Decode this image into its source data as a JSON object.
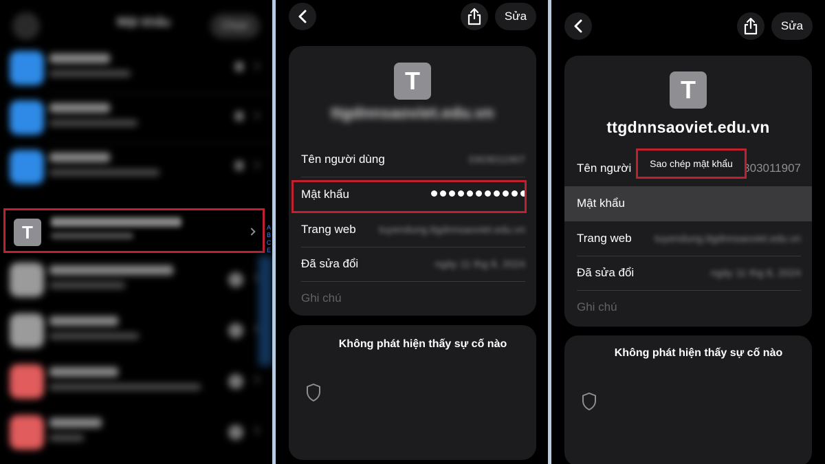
{
  "panel1": {
    "header": {
      "title": "Mật khẩu",
      "filter_label": "Chọn"
    },
    "rows_top": [
      {
        "icon_color": "#2e8ae6",
        "title": "Trankiko",
        "subtitle": "ttgdnnsaoviet.edu.vn",
        "count": "2"
      },
      {
        "icon_color": "#2e8ae6",
        "title": "Trankiko",
        "subtitle": "ttgdnnsaoviet.edu.vn",
        "count": "2"
      },
      {
        "icon_color": "#2e8ae6",
        "title": "Trankiko",
        "subtitle": "Phan Thị Thanh Thanh",
        "count": "2"
      }
    ],
    "selected": {
      "tile_letter": "T",
      "title": "ttgdnnsaoviet.edu.vn",
      "subtitle": "0303011907"
    },
    "index_letters": [
      "A",
      "B",
      "C",
      "E"
    ],
    "rows_bottom": [
      {
        "icon_color": "#9b9b9b",
        "title": "ttgdnnsaoviet.edu.vn",
        "subtitle": "0303011907"
      },
      {
        "icon_color": "#9b9b9b",
        "title": "ttgdnnsaoviet.edu.vn",
        "subtitle": "0303011907"
      },
      {
        "icon_color": "#e15c5c",
        "title": "Trankiko",
        "subtitle": "Phan Thị Thanh Thanh Thanh"
      },
      {
        "icon_color": "#e15c5c",
        "title": "Trankiko",
        "subtitle": "0303011907"
      }
    ]
  },
  "panel2": {
    "edit_label": "Sửa",
    "tile_letter": "T",
    "site_title": "ttgdnnsaoviet.edu.vn",
    "username_label": "Tên người dùng",
    "username_value": "0303011907",
    "password_label": "Mật khẩu",
    "website_label": "Trang web",
    "website_value": "tuyendung.ttgdnnsaoviet.edu.vn",
    "modified_label": "Đã sửa đổi",
    "modified_value": "ngày 11 thg 8, 2024",
    "notes_label": "Ghi chú",
    "security_title": "Không phát hiện thấy sự cố nào"
  },
  "panel3": {
    "edit_label": "Sửa",
    "tile_letter": "T",
    "site_title": "ttgdnnsaoviet.edu.vn",
    "username_label": "Tên người",
    "username_value": "0303011907",
    "copy_popup_label": "Sao chép mật khẩu",
    "password_label": "Mật khẩu",
    "website_label": "Trang web",
    "website_value": "tuyendung.ttgdnnsaoviet.edu.vn",
    "modified_label": "Đã sửa đổi",
    "modified_value": "ngày 11 thg 8, 2024",
    "notes_label": "Ghi chú",
    "security_title": "Không phát hiện thấy sự cố nào"
  },
  "colors": {
    "highlight_box": "#c1202e",
    "card_bg": "#1c1c1e",
    "tile_gray": "#8e8e93",
    "divider": "#b7cce0"
  }
}
